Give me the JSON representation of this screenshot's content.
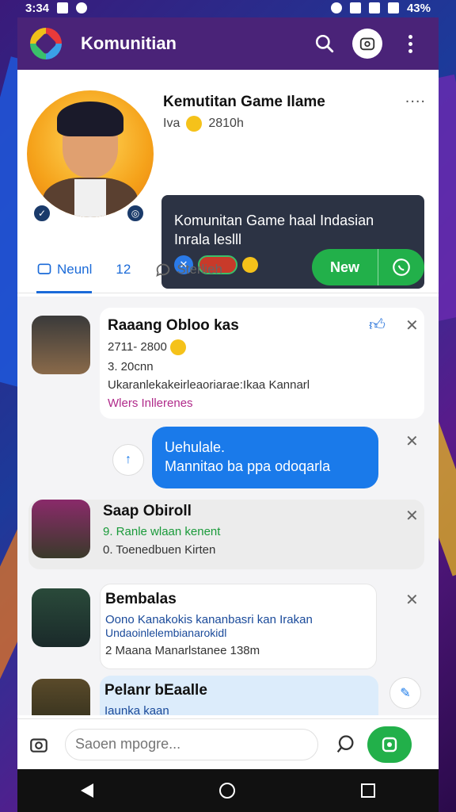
{
  "status_bar": {
    "time": "3:34",
    "battery": "43%"
  },
  "app": {
    "title": "Komunitian",
    "icons": [
      "search-icon",
      "camera-icon",
      "more-vert-icon"
    ]
  },
  "profile": {
    "name": "Kemutitan Game Ilame",
    "meta_left": "Iva",
    "meta_time": "2810h",
    "more": "....",
    "info_title": "Komunitan Game haal Indasian Inrala leslll"
  },
  "tabs": [
    {
      "label": "Neunl",
      "count": ""
    },
    {
      "label": "",
      "count": "12"
    },
    {
      "label": "Sterlieh",
      "count": ""
    }
  ],
  "new_button": {
    "label": "New"
  },
  "posts": [
    {
      "title": "Raaang Obloo kas",
      "line1": "2711- 2800",
      "line2": "3. 20cnn",
      "line3": "Ukaranlekakeirleaoriarae:Ikaa Kannarl",
      "line4": "Wlers Inllerenes"
    },
    {
      "reply_line1": "Uehulale.",
      "reply_line2": "Mannitao ba ppa odoqarla"
    },
    {
      "title": "Saap Obiroll",
      "line1": "9. Ranle wlaan kenent",
      "line2": "0. Toenedbuen Kirten"
    },
    {
      "title": "Bembalas",
      "line1": "Oono Kanakokis kananbasri kan Irakan",
      "line2": "Undaoinlelembianarokidl",
      "line3": "2 Maana Manarlstanee",
      "line4": "138m"
    },
    {
      "title": "Pelanr bEaalle",
      "line1": "Iaunka kaan"
    }
  ],
  "composer": {
    "placeholder": "Saoen mpogre..."
  }
}
